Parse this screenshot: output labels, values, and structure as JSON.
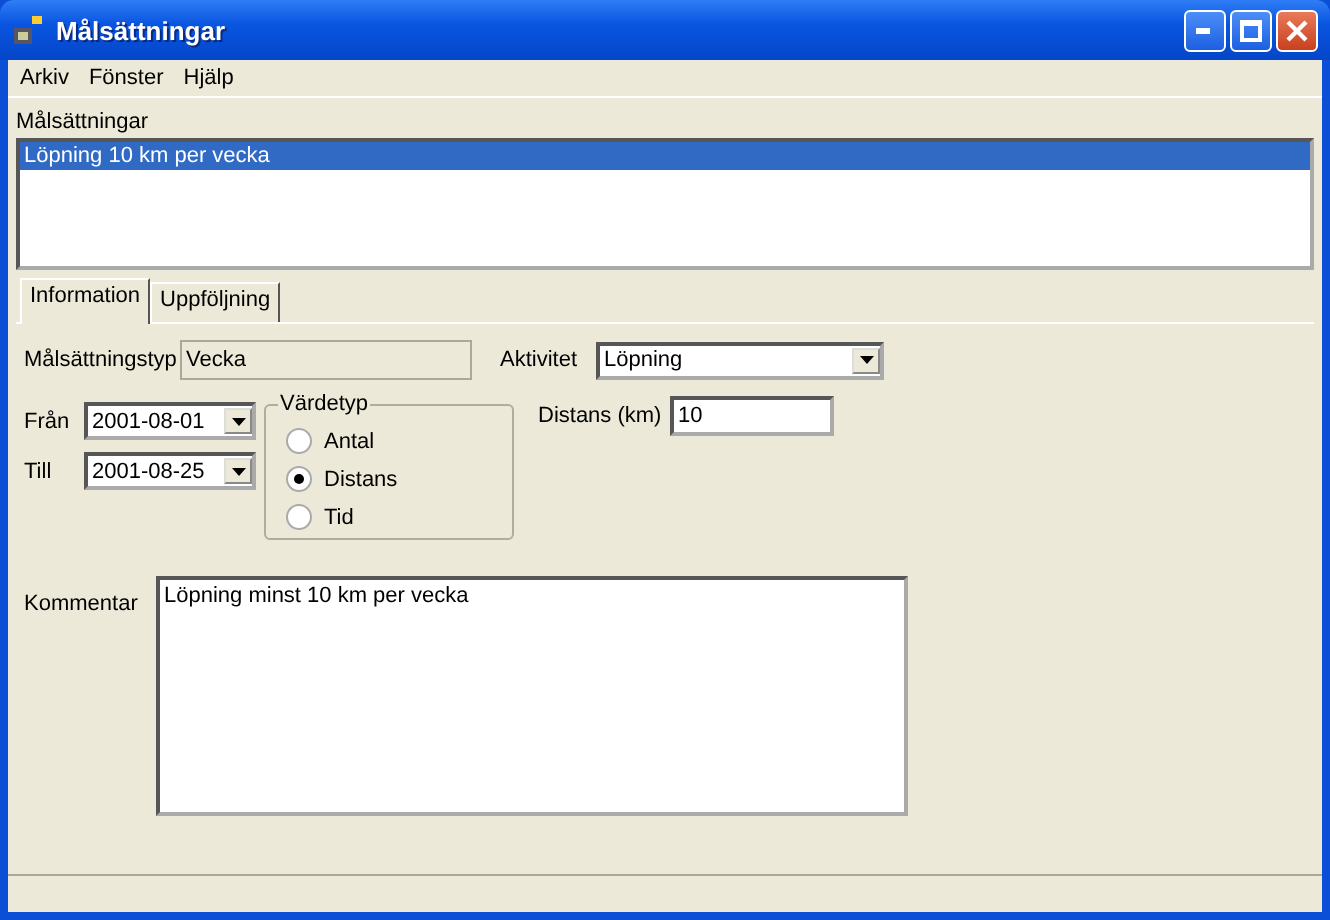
{
  "window": {
    "title": "Målsättningar"
  },
  "menu": [
    "Arkiv",
    "Fönster",
    "Hjälp"
  ],
  "goals": {
    "label": "Målsättningar",
    "items": [
      {
        "text": "Löpning 10 km per vecka",
        "selected": true
      }
    ]
  },
  "tabs": [
    {
      "label": "Information",
      "selected": true
    },
    {
      "label": "Uppföljning",
      "selected": false
    }
  ],
  "form": {
    "type_label": "Målsättningstyp",
    "type_value": "Vecka",
    "activity_label": "Aktivitet",
    "activity_value": "Löpning",
    "from_label": "Från",
    "from_value": "2001-08-01",
    "to_label": "Till",
    "to_value": "2001-08-25",
    "value_type": {
      "label": "Värdetyp",
      "options": [
        {
          "label": "Antal",
          "selected": false
        },
        {
          "label": "Distans",
          "selected": true
        },
        {
          "label": "Tid",
          "selected": false
        }
      ]
    },
    "distance_label": "Distans (km)",
    "distance_value": "10",
    "comment_label": "Kommentar",
    "comment_value": "Löpning minst 10 km per vecka"
  }
}
